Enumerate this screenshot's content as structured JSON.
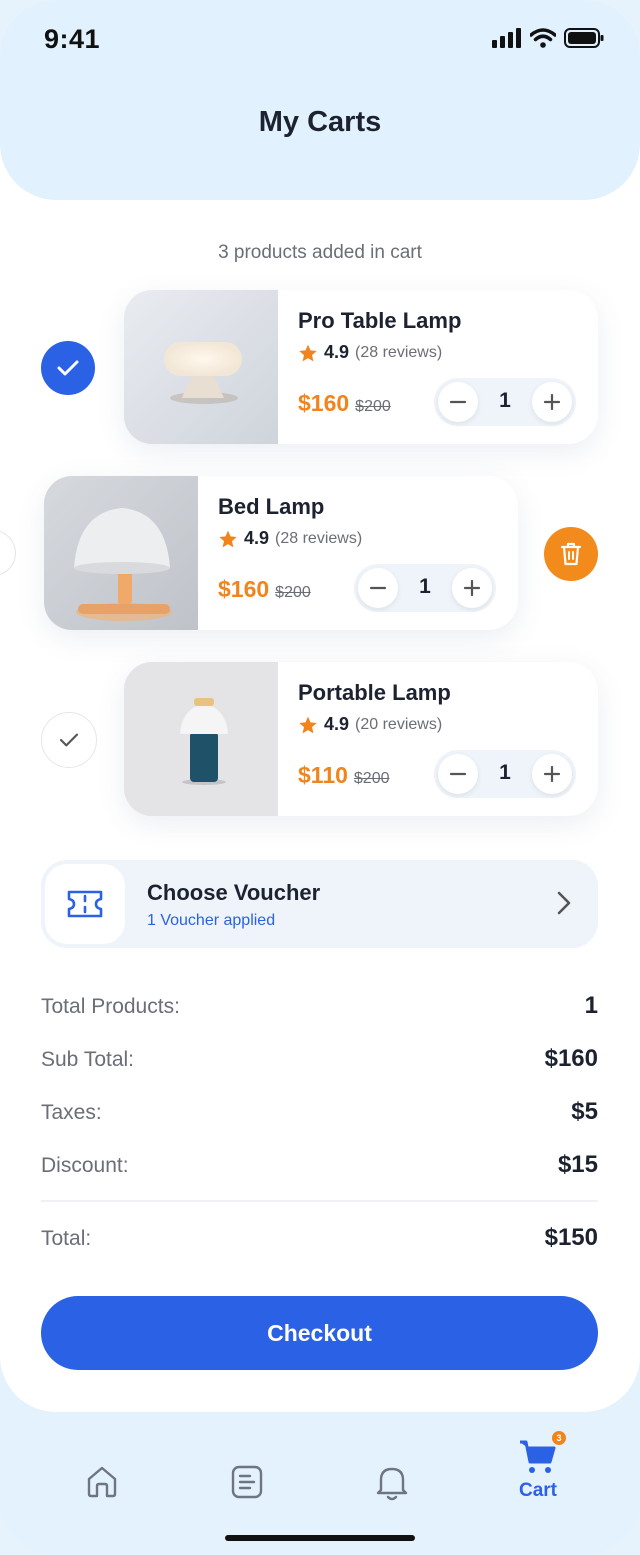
{
  "status": {
    "time": "9:41"
  },
  "header": {
    "title": "My Carts"
  },
  "cart": {
    "count_text": "3 products added in cart",
    "items": [
      {
        "name": "Pro Table Lamp",
        "rating": "4.9",
        "reviews": "(28 reviews)",
        "price": "$160",
        "old_price": "$200",
        "qty": "1",
        "selected": true
      },
      {
        "name": "Bed Lamp",
        "rating": "4.9",
        "reviews": "(28 reviews)",
        "price": "$160",
        "old_price": "$200",
        "qty": "1",
        "selected": false
      },
      {
        "name": "Portable Lamp",
        "rating": "4.9",
        "reviews": "(20 reviews)",
        "price": "$110",
        "old_price": "$200",
        "qty": "1",
        "selected": false
      }
    ]
  },
  "voucher": {
    "title": "Choose Voucher",
    "subtitle": "1 Voucher applied"
  },
  "summary": {
    "total_products_label": "Total Products:",
    "total_products_value": "1",
    "subtotal_label": "Sub Total:",
    "subtotal_value": "$160",
    "taxes_label": "Taxes:",
    "taxes_value": "$5",
    "discount_label": "Discount:",
    "discount_value": "$15",
    "total_label": "Total:",
    "total_value": "$150"
  },
  "checkout_label": "Checkout",
  "nav": {
    "cart_label": "Cart",
    "cart_badge": "3"
  },
  "colors": {
    "primary": "#2b61e4",
    "accent": "#f2841c",
    "header_bg": "#e1f1fd"
  }
}
